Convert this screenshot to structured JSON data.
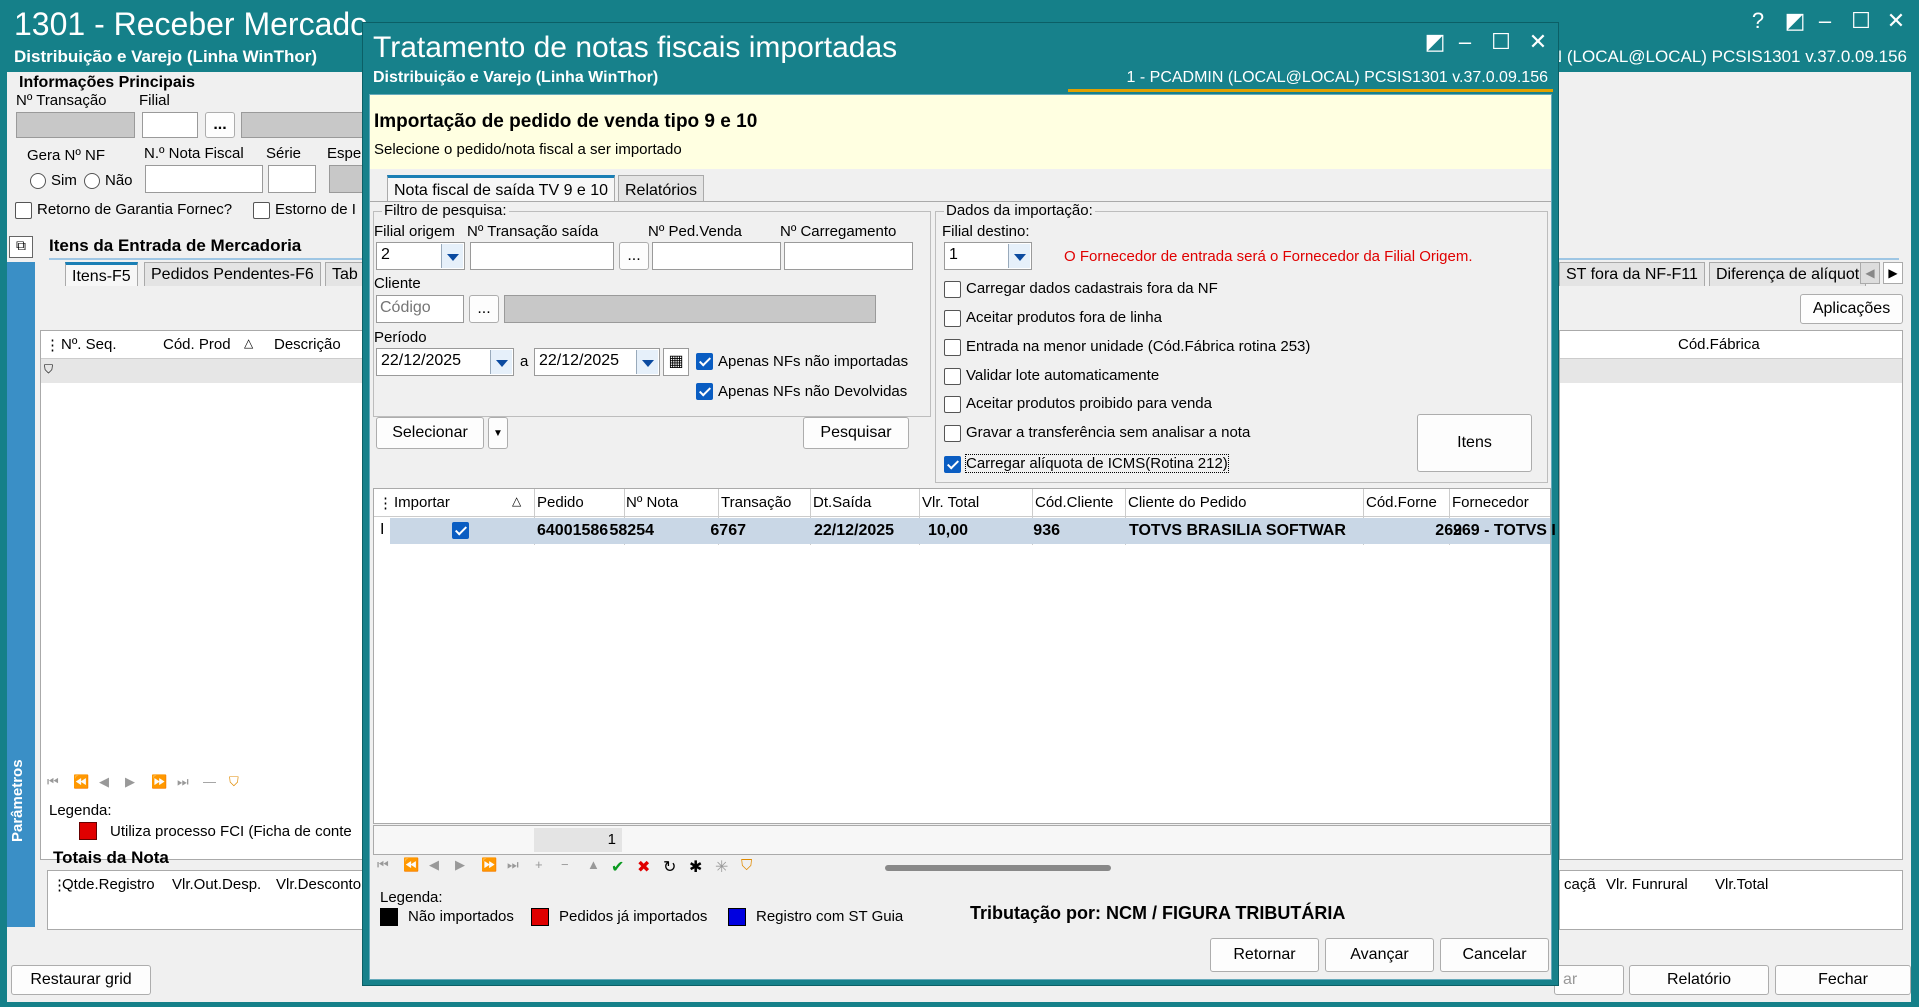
{
  "background_window": {
    "title": "1301 - Receber Mercado",
    "subtitle": "Distribuição e Varejo (Linha WinThor)",
    "user_line": "N (LOCAL@LOCAL)   PCSIS1301  v.37.0.09.156",
    "info_heading": "Informações Principais",
    "labels": {
      "n_transacao": "Nº Transação",
      "filial": "Filial",
      "gera_nf": "Gera Nº NF",
      "nota_fiscal": "N.º Nota Fiscal",
      "serie": "Série",
      "espe": "Espe",
      "sim": "Sim",
      "nao": "Não",
      "retorno_garantia": "Retorno de Garantia Fornec?",
      "estorno": "Estorno de I",
      "itens_entrada": "Itens da Entrada de Mercadoria",
      "legenda": "Legenda:",
      "legenda_item": "Utiliza processo FCI (Ficha de conte",
      "totais": "Totais da Nota",
      "parametros": "Parâmetros"
    },
    "filial_button": "...",
    "tabs": [
      "Itens-F5",
      "Pedidos Pendentes-F6",
      "Tab"
    ],
    "right_tabs": [
      "ST fora da NF-F11",
      "Diferença de alíquot"
    ],
    "aplicacoes_button": "Aplicações",
    "grid_headers": [
      "Nº. Seq.",
      "Cód. Prod",
      "Descrição"
    ],
    "right_grid_header": "Cód.Fábrica",
    "totals_headers": [
      "Qtde.Registro",
      "Vlr.Out.Desp.",
      "Vlr.Desconto"
    ],
    "totals_right_headers": [
      "caçã",
      "Vlr. Funrural",
      "Vlr.Total"
    ],
    "bottom_buttons": {
      "restaurar": "Restaurar grid",
      "ar": "ar",
      "relatorio": "Relatório",
      "fechar": "Fechar"
    }
  },
  "dialog": {
    "title": "Tratamento de notas fiscais importadas",
    "subtitle": "Distribuição e Varejo (Linha WinThor)",
    "user_line": "1 - PCADMIN (LOCAL@LOCAL)   PCSIS1301  v.37.0.09.156",
    "banner_title": "Importação de pedido de venda tipo 9 e 10",
    "banner_text": "Selecione o pedido/nota fiscal a ser importado",
    "tabs": [
      "Nota fiscal de saída TV 9 e 10",
      "Relatórios"
    ],
    "filtro": {
      "heading": "Filtro de pesquisa:",
      "filial_origem_label": "Filial origem",
      "filial_origem_value": "2",
      "transacao_saida_label": "Nº Transação saída",
      "transacao_saida_value": "",
      "ped_venda_label": "Nº Ped.Venda",
      "carregamento_label": "Nº Carregamento",
      "cliente_label": "Cliente",
      "cliente_placeholder": "Código",
      "ellipsis": "...",
      "periodo_label": "Período",
      "data_inicio": "22/12/2025",
      "a_label": "a",
      "data_fim": "22/12/2025",
      "apenas_nao_importadas": "Apenas NFs não importadas",
      "apenas_nao_devolvidas": "Apenas NFs não Devolvidas",
      "selecionar_button": "Selecionar",
      "pesquisar_button": "Pesquisar"
    },
    "importacao": {
      "heading": "Dados da importação:",
      "filial_destino_label": "Filial destino:",
      "filial_destino_value": "1",
      "aviso": "O Fornecedor de entrada será o Fornecedor da Filial Origem.",
      "options": [
        {
          "label": "Carregar dados cadastrais fora da NF",
          "checked": false
        },
        {
          "label": "Aceitar produtos fora de linha",
          "checked": false
        },
        {
          "label": "Entrada na menor unidade (Cód.Fábrica rotina 253)",
          "checked": false
        },
        {
          "label": "Validar lote automaticamente",
          "checked": false
        },
        {
          "label": "Aceitar produtos proibido para venda",
          "checked": false
        },
        {
          "label": "Gravar a transferência sem analisar a nota",
          "checked": false
        },
        {
          "label": "Carregar alíquota de ICMS(Rotina 212)",
          "checked": true
        }
      ],
      "itens_button": "Itens"
    },
    "grid": {
      "headers": [
        "Importar",
        "Pedido",
        "Nº Nota",
        "Transação",
        "Dt.Saída",
        "Vlr. Total",
        "Cód.Cliente",
        "Cliente do Pedido",
        "Cód.Forne",
        "Fornecedor"
      ],
      "rows": [
        {
          "importar": true,
          "pedido": "64001586",
          "nota": "58254",
          "transacao": "6767",
          "dt_saida": "22/12/2025",
          "vlr_total": "10,00",
          "cod_cliente": "936",
          "cliente": "TOTVS BRASILIA SOFTWAR",
          "cod_forne": "269",
          "fornecedor": "269 - TOTVS I"
        }
      ],
      "footer_count": "1"
    },
    "legenda": {
      "title": "Legenda:",
      "items": [
        {
          "label": "Não importados",
          "color": "#000000"
        },
        {
          "label": "Pedidos já importados",
          "color": "#e00000"
        },
        {
          "label": "Registro com ST Guia",
          "color": "#0000e0"
        }
      ]
    },
    "tributacao": "Tributação por: NCM / FIGURA TRIBUTÁRIA",
    "buttons": {
      "retornar": "Retornar",
      "avancar": "Avançar",
      "cancelar": "Cancelar"
    }
  },
  "colors": {
    "title_bar": "#17818b",
    "banner": "#ffffe1",
    "selected_row": "#c9d7e6",
    "warning_text": "#e00000",
    "accent": "#0a5dc2"
  }
}
